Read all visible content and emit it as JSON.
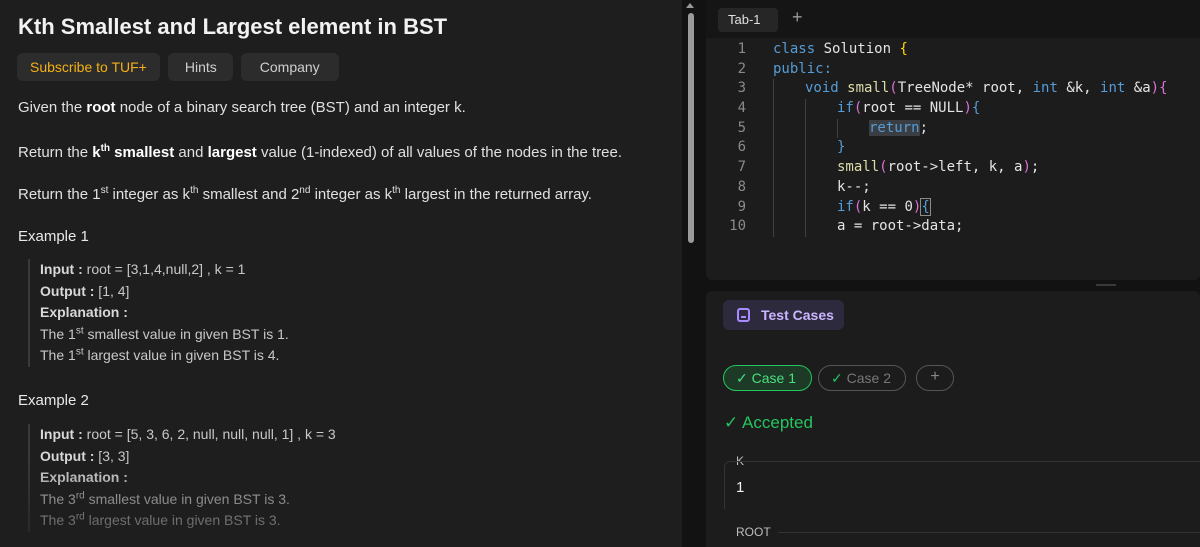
{
  "problem": {
    "title": "Kth Smallest and Largest element in BST",
    "chips": [
      "Subscribe to TUF+",
      "Hints",
      "Company"
    ],
    "p1": {
      "a": "Given the ",
      "b": "root",
      "c": " node of a binary search tree (BST) and an integer k."
    },
    "p2": {
      "a": "Return the ",
      "k": "k",
      "sup": "th",
      "b1": " smallest",
      "mid": " and ",
      "b2": "largest",
      "c": " value (1-indexed) of all values of the nodes in the tree."
    },
    "p3": {
      "a": "Return the 1",
      "sup1": "st",
      "b": " integer as k",
      "sup2": "th",
      "c": " smallest and 2",
      "sup3": "nd",
      "d": " integer as k",
      "sup4": "th",
      "e": " largest in the returned array."
    },
    "example1": {
      "title": "Example 1",
      "input_label": "Input :",
      "input": " root = [3,1,4,null,2] , k = 1",
      "output_label": "Output :",
      "output": " [1, 4]",
      "explanation_label": "Explanation :",
      "e1a": "The 1",
      "e1sup": "st",
      "e1b": " smallest value in given BST is 1.",
      "e2a": "The 1",
      "e2sup": "st",
      "e2b": " largest value in given BST is 4."
    },
    "example2": {
      "title": "Example 2",
      "input_label": "Input :",
      "input": " root = [5, 3, 6, 2, null, null, null, 1] , k = 3",
      "output_label": "Output :",
      "output": " [3, 3]",
      "explanation_label": "Explanation :",
      "e1a": "The 3",
      "e1sup": "rd",
      "e1b": " smallest value in given BST is 3.",
      "e2a": "The 3",
      "e2sup": "rd",
      "e2b": " largest value in given BST is 3."
    }
  },
  "editor": {
    "tab": "Tab-1",
    "add_tab": "+",
    "line_numbers": [
      "1",
      "2",
      "3",
      "4",
      "5",
      "6",
      "7",
      "8",
      "9",
      "10"
    ],
    "code": {
      "l1a": "class",
      "l1b": " Solution ",
      "l1c": "{",
      "l2": "public:",
      "l3a": "void",
      "l3b": " small",
      "l3c": "(",
      "l3d": "TreeNode* root, ",
      "l3e": "int",
      "l3f": " &k, ",
      "l3g": "int",
      "l3h": " &a",
      "l3i": ")",
      "l3j": "{",
      "l4a": "if",
      "l4b": "(",
      "l4c": "root == NULL",
      "l4d": ")",
      "l4e": "{",
      "l5a": "return",
      "l5b": ";",
      "l6": "}",
      "l7a": "small",
      "l7b": "(",
      "l7c": "root->left, k, a",
      "l7d": ")",
      "l7e": ";",
      "l8": "k--;",
      "l9a": "if",
      "l9b": "(",
      "l9c": "k == 0",
      "l9d": ")",
      "l9e": "{",
      "l10": "a = root->data;"
    }
  },
  "tests": {
    "button": "Test Cases",
    "case1": "Case 1",
    "case2": "Case 2",
    "check": "✓",
    "add": "+",
    "status": "Accepted",
    "field_k_label": "K",
    "field_k_value": "1",
    "field_root_label": "ROOT"
  },
  "colors": {
    "accent_purple": "#a98bff",
    "success_green": "#22c55e",
    "tuf_gold": "#f5b014"
  }
}
